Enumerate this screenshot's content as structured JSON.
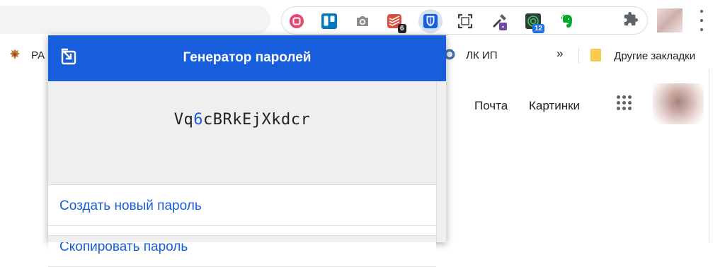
{
  "toolbar": {
    "extensions": [
      {
        "name": "record-icon",
        "badge": ""
      },
      {
        "name": "trello-icon",
        "badge": ""
      },
      {
        "name": "camera-icon",
        "badge": ""
      },
      {
        "name": "todoist-icon",
        "badge": "6"
      },
      {
        "name": "bitwarden-icon",
        "badge": ""
      },
      {
        "name": "screenshot-icon",
        "badge": ""
      },
      {
        "name": "color-picker-icon",
        "badge": ""
      },
      {
        "name": "radar-icon",
        "badge": "12"
      },
      {
        "name": "evernote-icon",
        "badge": ""
      }
    ],
    "colors": {
      "todoist": "#db4c3f",
      "trello": "#0079bf",
      "bitwarden": "#175ddc",
      "evernote": "#00a82d"
    }
  },
  "bookmarks": {
    "items": [
      {
        "label": "РА"
      },
      {
        "label": "ЛК ИП"
      }
    ],
    "more": "»",
    "other_bookmarks": "Другие закладки"
  },
  "page": {
    "mail_link": "Почта",
    "images_link": "Картинки"
  },
  "popup": {
    "title": "Генератор паролей",
    "password_parts": {
      "a": "Vq",
      "digit": "6",
      "b": "cBRkEjXkdcr"
    },
    "generate_label": "Создать новый пароль",
    "copy_label": "Скопировать пароль",
    "accent": "#175ddc"
  }
}
